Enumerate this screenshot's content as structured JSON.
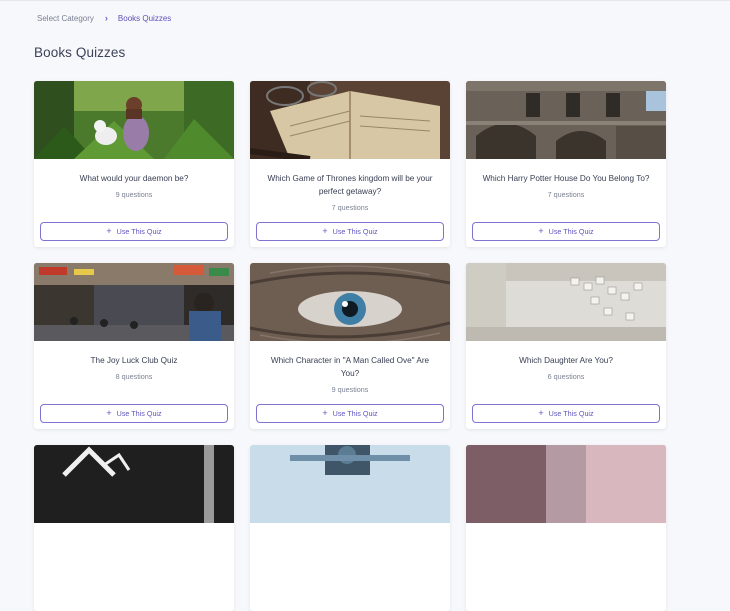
{
  "breadcrumb": {
    "root": "Select Category",
    "separator": "›",
    "current": "Books Quizzes"
  },
  "page_title": "Books Quizzes",
  "button_icon": "plus-icon",
  "quizzes": [
    {
      "title": "What would your daemon be?",
      "count": "9 questions",
      "button": "Use This Quiz",
      "image": "girl-with-dog-in-grass"
    },
    {
      "title": "Which Game of Thrones kingdom will be your perfect getaway?",
      "count": "7 questions",
      "button": "Use This Quiz",
      "image": "open-book-with-glasses"
    },
    {
      "title": "Which Harry Potter House Do You Belong To?",
      "count": "7 questions",
      "button": "Use This Quiz",
      "image": "stone-castle-ruins"
    },
    {
      "title": "The Joy Luck Club Quiz",
      "count": "8 questions",
      "button": "Use This Quiz",
      "image": "busy-asian-street"
    },
    {
      "title": "Which Character in \"A Man Called Ove\" Are You?",
      "count": "9 questions",
      "button": "Use This Quiz",
      "image": "close-up-eye"
    },
    {
      "title": "Which Daughter Are You?",
      "count": "6 questions",
      "button": "Use This Quiz",
      "image": "mahjong-tiles"
    }
  ],
  "partial_images": [
    "dark-silhouette",
    "sky-ornament",
    "pink-flowers"
  ],
  "colors": {
    "accent": "#5f55bf",
    "background": "#f7f8fb"
  }
}
